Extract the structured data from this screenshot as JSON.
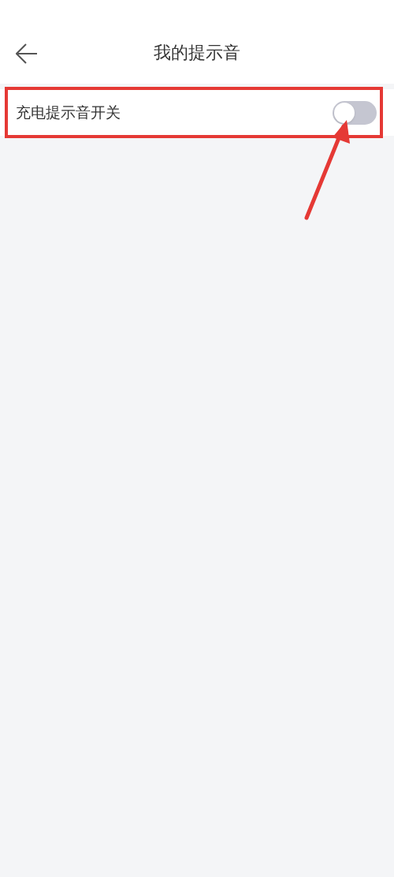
{
  "header": {
    "title": "我的提示音"
  },
  "settings": [
    {
      "label": "充电提示音开关",
      "kind": "toggle",
      "on": false
    }
  ]
}
